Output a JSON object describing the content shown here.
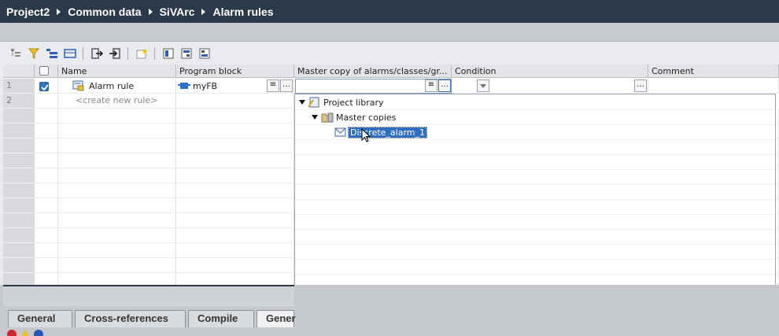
{
  "breadcrumb": [
    "Project2",
    "Common data",
    "SiVArc",
    "Alarm rules"
  ],
  "toolbar": {
    "icons": [
      "tree-view-icon",
      "filter-icon",
      "expand-all-icon",
      "collapse-all-icon",
      "export-icon",
      "import-icon",
      "add-rule-icon",
      "column-icon-1",
      "column-icon-2",
      "column-icon-3"
    ]
  },
  "table": {
    "columns": [
      "Name",
      "Program block",
      "Master copy of alarms/classes/gr...",
      "Condition",
      "Comment"
    ],
    "rows": [
      {
        "num": "1",
        "checked": true,
        "name": "Alarm rule",
        "program_block": "myFB",
        "master_copy": "",
        "condition": "",
        "comment": ""
      },
      {
        "num": "2",
        "checked": false,
        "name": "<create new rule>",
        "program_block": "",
        "master_copy": "",
        "condition": "",
        "comment": ""
      }
    ],
    "empty_row_count": 12
  },
  "dropdown": {
    "tree": [
      {
        "label": "Project library",
        "level": 0,
        "expanded": true
      },
      {
        "label": "Master copies",
        "level": 1,
        "expanded": true
      },
      {
        "label": "Discrete_alarm_1",
        "level": 2,
        "selected": true
      }
    ],
    "ok_color": "#2e9b34",
    "cancel_color": "#1f4fb0"
  },
  "bottom_tabs": [
    "General",
    "Cross-references",
    "Compile",
    "Gener"
  ],
  "colors": {
    "titlebar": "#2b3a4a",
    "selection": "#2f6fbf",
    "checkbox": "#2f77bd"
  }
}
